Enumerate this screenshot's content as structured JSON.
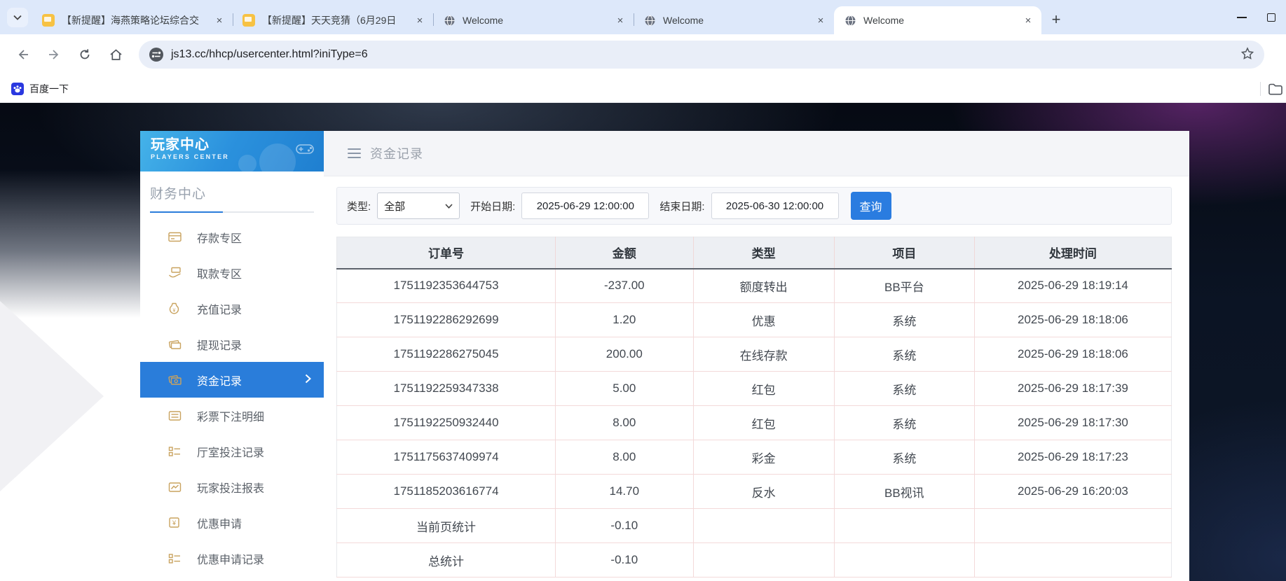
{
  "browser": {
    "tabs": [
      {
        "title": "【新提醒】海燕策略论坛综合交",
        "icon": "chat-yellow",
        "active": false
      },
      {
        "title": "【新提醒】天天竞猜（6月29日",
        "icon": "chat-yellow",
        "active": false
      },
      {
        "title": "Welcome",
        "icon": "globe",
        "active": false
      },
      {
        "title": "Welcome",
        "icon": "globe",
        "active": false
      },
      {
        "title": "Welcome",
        "icon": "globe",
        "active": true
      }
    ],
    "url": "js13.cc/hhcp/usercenter.html?iniType=6",
    "bookmarks": [
      {
        "label": "百度一下"
      }
    ]
  },
  "sidebar": {
    "title": "玩家中心",
    "subtitle": "PLAYERS CENTER",
    "section_title": "财务中心",
    "items": [
      {
        "label": "存款专区",
        "active": false
      },
      {
        "label": "取款专区",
        "active": false
      },
      {
        "label": "充值记录",
        "active": false
      },
      {
        "label": "提现记录",
        "active": false
      },
      {
        "label": "资金记录",
        "active": true
      },
      {
        "label": "彩票下注明细",
        "active": false
      },
      {
        "label": "厅室投注记录",
        "active": false
      },
      {
        "label": "玩家投注报表",
        "active": false
      },
      {
        "label": "优惠申请",
        "active": false
      },
      {
        "label": "优惠申请记录",
        "active": false
      }
    ]
  },
  "main": {
    "page_title": "资金记录",
    "filters": {
      "type_label": "类型:",
      "type_value": "全部",
      "start_label": "开始日期:",
      "start_value": "2025-06-29 12:00:00",
      "end_label": "结束日期:",
      "end_value": "2025-06-30 12:00:00",
      "search_button": "查询"
    },
    "table": {
      "columns": [
        "订单号",
        "金额",
        "类型",
        "项目",
        "处理时间"
      ],
      "rows": [
        [
          "1751192353644753",
          "-237.00",
          "额度转出",
          "BB平台",
          "2025-06-29 18:19:14"
        ],
        [
          "1751192286292699",
          "1.20",
          "优惠",
          "系统",
          "2025-06-29 18:18:06"
        ],
        [
          "1751192286275045",
          "200.00",
          "在线存款",
          "系统",
          "2025-06-29 18:18:06"
        ],
        [
          "1751192259347338",
          "5.00",
          "红包",
          "系统",
          "2025-06-29 18:17:39"
        ],
        [
          "1751192250932440",
          "8.00",
          "红包",
          "系统",
          "2025-06-29 18:17:30"
        ],
        [
          "1751175637409974",
          "8.00",
          "彩金",
          "系统",
          "2025-06-29 18:17:23"
        ],
        [
          "1751185203616774",
          "14.70",
          "反水",
          "BB视讯",
          "2025-06-29 16:20:03"
        ],
        [
          "当前页统计",
          "-0.10",
          "",
          "",
          ""
        ],
        [
          "总统计",
          "-0.10",
          "",
          "",
          ""
        ]
      ]
    }
  },
  "colors": {
    "accent_blue": "#2a7dda",
    "query_button_blue": "#2a7ce0",
    "sidebar_icon_gold": "#c9a35f",
    "tabstrip_blue": "#dde8fa",
    "table_grid_pink": "#f3dada",
    "header_gray": "#edeff3"
  }
}
